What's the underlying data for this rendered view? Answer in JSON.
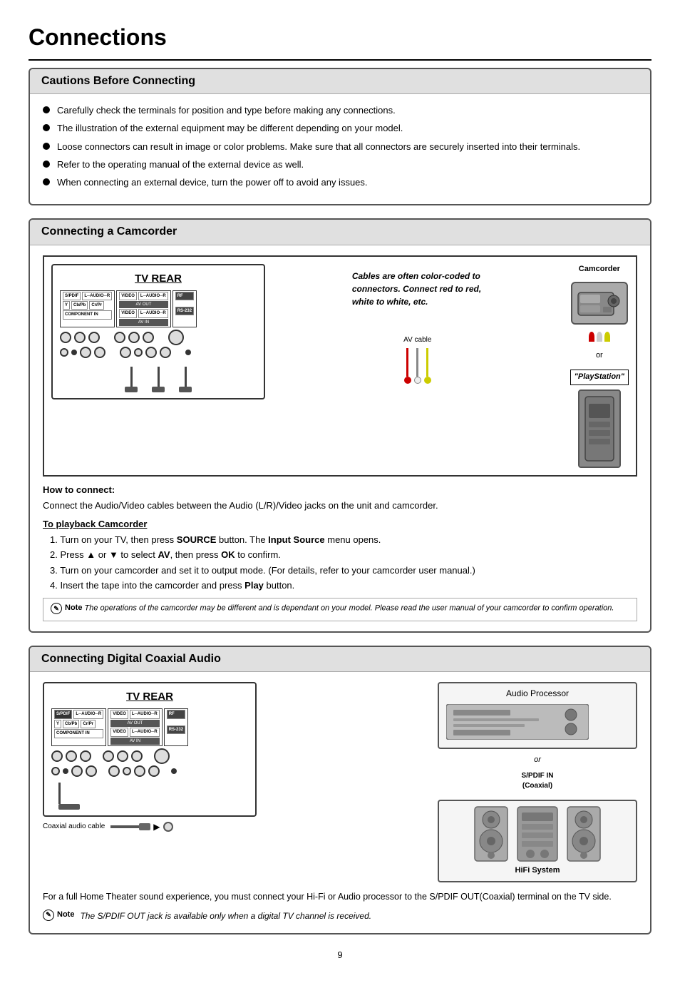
{
  "page": {
    "title": "Connections",
    "page_number": "9"
  },
  "cautions": {
    "header": "Cautions Before Connecting",
    "items": [
      "Carefully check the terminals for position and type before making any connections.",
      "The illustration of the external equipment may be different depending on your model.",
      "Loose connectors can result in image or color problems. Make sure that all connectors are securely inserted into their terminals.",
      "Refer to the operating manual of the external device as well.",
      "When connecting an external device, turn the power off to avoid any issues."
    ]
  },
  "camcorder": {
    "header": "Connecting a Camcorder",
    "tv_rear_label": "TV REAR",
    "cables_note": "Cables are often color-coded to connectors. Connect red to red, white to white, etc.",
    "camcorder_label": "Camcorder",
    "playstation_label": "\"PlayStation\"",
    "or_label": "or",
    "av_cable_label": "AV cable",
    "how_to_connect_title": "How to connect:",
    "how_to_connect_desc": "Connect the Audio/Video cables between the Audio (L/R)/Video jacks on the unit and camcorder.",
    "playback_title": "To playback Camcorder",
    "steps": [
      "1. Turn on your TV,  then press SOURCE button. The Input Source menu opens.",
      "2. Press ▲ or ▼ to select AV, then press OK to confirm.",
      "3. Turn on your camcorder and set it to output mode.  (For details, refer to your camcorder user manual.)",
      "4. Insert the tape into the camcorder and press Play button."
    ],
    "note_label": "Note",
    "note_text": "The operations of the camcorder may be different and is dependant on your model. Please read the user manual of your camcorder to confirm operation."
  },
  "coaxial": {
    "header": "Connecting Digital Coaxial Audio",
    "tv_rear_label": "TV REAR",
    "coaxial_cable_label": "Coaxial audio cable",
    "spdif_in_label": "S/PDIF IN\n(Coaxial)",
    "audio_processor_label": "Audio  Processor",
    "or_label": "or",
    "hifi_label": "HiFi  System",
    "bottom_text1": "For a full Home Theater sound experience, you must connect your Hi-Fi or Audio processor to the S/PDIF OUT(Coaxial) terminal on the TV side.",
    "note_label": "Note",
    "note_text2": "The S/PDIF OUT jack is available only when a digital TV channel is received."
  },
  "labels": {
    "spdif": "S/PDIF",
    "l_audio_r": "L-AUDIO-R",
    "video": "VIDEO",
    "l_audio_r2": "L-AUDIO-R",
    "rf": "RF",
    "av_out": "AV OUT",
    "y": "Y",
    "cb_pb": "Cb/Pb",
    "cr_pr": "Cr/Pr",
    "component_in": "COMPONENT IN",
    "video2": "VIDEO",
    "l_audio_r3": "L-AUDIO-R",
    "av_in": "AV IN",
    "rs232": "RS-232"
  }
}
